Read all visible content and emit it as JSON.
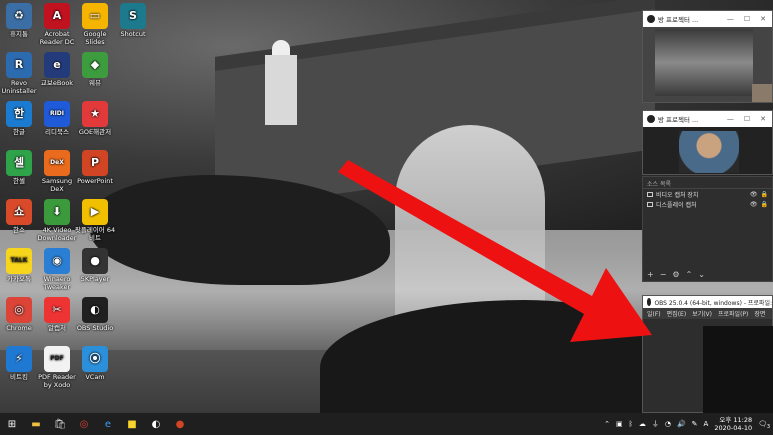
{
  "desktop": {
    "icons": [
      {
        "label": "휴지통",
        "color": "#3a6ea5",
        "glyph": "♻"
      },
      {
        "label": "Acrobat Reader DC",
        "color": "#c1121f",
        "glyph": "A"
      },
      {
        "label": "Google Slides",
        "color": "#f4b400",
        "glyph": "▭"
      },
      {
        "label": "Shotcut",
        "color": "#1d7a8c",
        "glyph": "S"
      },
      {
        "label": "Revo Uninstaller",
        "color": "#2d6bb0",
        "glyph": "R"
      },
      {
        "label": "교보eBook",
        "color": "#233b7a",
        "glyph": "e"
      },
      {
        "label": "웨뷰",
        "color": "#3d9c3d",
        "glyph": "◆"
      },
      {
        "label": "한글",
        "color": "#1b7bd0",
        "glyph": "한"
      },
      {
        "label": "리디북스",
        "color": "#1f5bd8",
        "glyph": "RIDI"
      },
      {
        "label": "GOE해관저",
        "color": "#e23a3a",
        "glyph": "★"
      },
      {
        "label": "한셀",
        "color": "#2ea34a",
        "glyph": "셀"
      },
      {
        "label": "Samsung DeX",
        "color": "#ea6b1d",
        "glyph": "DeX"
      },
      {
        "label": "PowerPoint",
        "color": "#d14424",
        "glyph": "P"
      },
      {
        "label": "한쇼",
        "color": "#d94a2a",
        "glyph": "쇼"
      },
      {
        "label": "4K Video Downloader",
        "color": "#3b9a3b",
        "glyph": "⬇"
      },
      {
        "label": "팟플레이어 64 비트",
        "color": "#f0c000",
        "glyph": "▶"
      },
      {
        "label": "카카오톡",
        "color": "#f7d51d",
        "glyph": "TALK"
      },
      {
        "label": "Winaero Tweaker",
        "color": "#2a7fd4",
        "glyph": "◉"
      },
      {
        "label": "5KPlayer",
        "color": "#333333",
        "glyph": "●"
      },
      {
        "label": "Chrome",
        "color": "#db4437",
        "glyph": "◎"
      },
      {
        "label": "알캡처",
        "color": "#e33",
        "glyph": "✂"
      },
      {
        "label": "OBS Studio",
        "color": "#202020",
        "glyph": "◐"
      },
      {
        "label": "비트킹",
        "color": "#1f78d1",
        "glyph": "⚡"
      },
      {
        "label": "PDF Reader by Xodo",
        "color": "#f2f2f2",
        "glyph": "PDF"
      },
      {
        "label": "VCam",
        "color": "#2b8fd9",
        "glyph": "⦿"
      }
    ]
  },
  "obs_windows": {
    "win1_title": "방 프로젝터 ...",
    "win2_title": "방 프로젝터 ...",
    "sources_header": "소스 목록",
    "sources": [
      {
        "label": "비디오 캡처 장치"
      },
      {
        "label": "디스플레이 캡처"
      }
    ],
    "main_title": "OBS 25.0.4 (64-bit, windows) - 프로파일:",
    "menu": [
      "일(F)",
      "편집(E)",
      "보기(V)",
      "프로파일(P)",
      "장면"
    ]
  },
  "taskbar": {
    "time": "오후 11:28",
    "date": "2020-04-10",
    "ime": "A",
    "notification_count": "3"
  },
  "colors": {
    "arrow": "#ee1111"
  }
}
